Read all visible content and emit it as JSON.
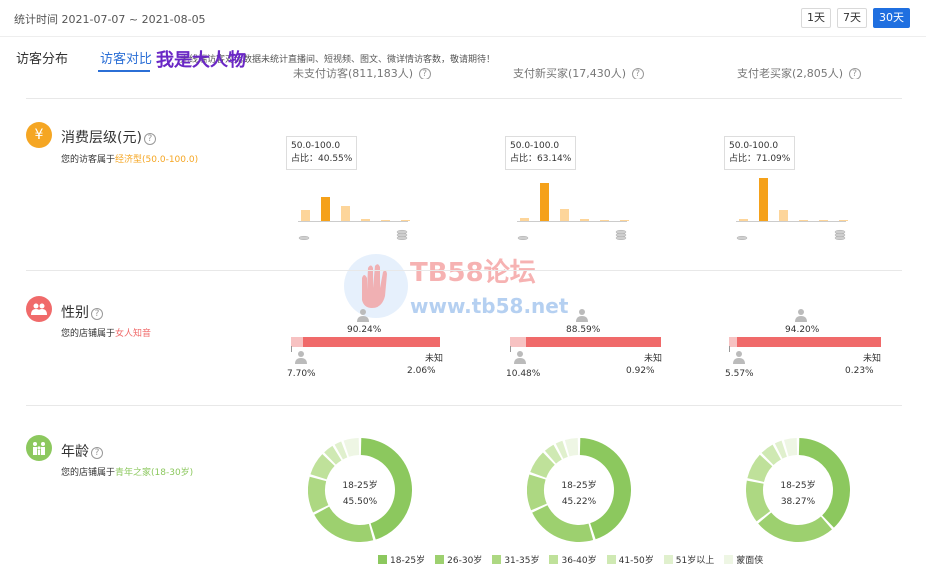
{
  "header": {
    "stat_time": "统计时间 2021-07-07 ~ 2021-08-05",
    "ranges": [
      "1天",
      "7天",
      "30天"
    ],
    "active_range": "30天"
  },
  "tabs": [
    {
      "label": "访客分布"
    },
    {
      "label": "访客对比"
    }
  ],
  "overlay_text": "我是大人物",
  "notice": "无线端访客对比数据未统计直播间、短视频、图文、微详情访客数，敬请期待！",
  "columns": [
    "未支付访客(811,183人)",
    "支付新买家(17,430人)",
    "支付老买家(2,805人)"
  ],
  "consumption": {
    "title": "消费层级(元)",
    "desc_prefix": "您的访客属于",
    "desc_value": "经济型(50.0-100.0)",
    "icon": "yen-icon",
    "color": "#f5a623",
    "columns": [
      {
        "tip_range": "50.0-100.0",
        "tip_ratio": "占比：40.55%",
        "values": [
          18,
          40.55,
          25,
          3,
          1,
          1
        ]
      },
      {
        "tip_range": "50.0-100.0",
        "tip_ratio": "占比：63.14%",
        "values": [
          5,
          63.14,
          20,
          3,
          1,
          1
        ]
      },
      {
        "tip_range": "50.0-100.0",
        "tip_ratio": "占比：71.09%",
        "values": [
          3,
          71.09,
          18,
          2,
          1,
          1
        ]
      }
    ]
  },
  "gender": {
    "title": "性别",
    "desc_prefix": "您的店铺属于",
    "desc_value": "女人知音",
    "icon": "people-icon",
    "color": "#f06a6a",
    "columns": [
      {
        "female": "90.24%",
        "male": "7.70%",
        "unknown_label": "未知",
        "unknown": "2.06%",
        "female_v": 90.24,
        "male_v": 7.7
      },
      {
        "female": "88.59%",
        "male": "10.48%",
        "unknown_label": "未知",
        "unknown": "0.92%",
        "female_v": 88.59,
        "male_v": 10.48
      },
      {
        "female": "94.20%",
        "male": "5.57%",
        "unknown_label": "未知",
        "unknown": "0.23%",
        "female_v": 94.2,
        "male_v": 5.57
      }
    ]
  },
  "age": {
    "title": "年龄",
    "desc_prefix": "您的店铺属于",
    "desc_value": "青年之家(18-30岁)",
    "icon": "family-icon",
    "color": "#8cc85e",
    "columns": [
      {
        "center_label": "18-25岁",
        "center_value": "45.50%",
        "values": [
          45.5,
          22,
          12,
          8,
          4,
          3,
          5.5
        ]
      },
      {
        "center_label": "18-25岁",
        "center_value": "45.22%",
        "values": [
          45.22,
          23,
          12,
          8,
          4,
          3,
          4.78
        ]
      },
      {
        "center_label": "18-25岁",
        "center_value": "38.27%",
        "values": [
          38.27,
          26,
          14,
          9,
          5,
          3,
          4.73
        ]
      }
    ],
    "legend": [
      "18-25岁",
      "26-30岁",
      "31-35岁",
      "36-40岁",
      "41-50岁",
      "51岁以上",
      "蒙面侠"
    ],
    "legend_colors": [
      "#8cc85e",
      "#9dd06f",
      "#add882",
      "#bfe19a",
      "#cfe9b3",
      "#e0f0cd",
      "#eef6e4"
    ]
  },
  "watermark": {
    "title": "TB58论坛",
    "url": "www.tb58.net"
  }
}
